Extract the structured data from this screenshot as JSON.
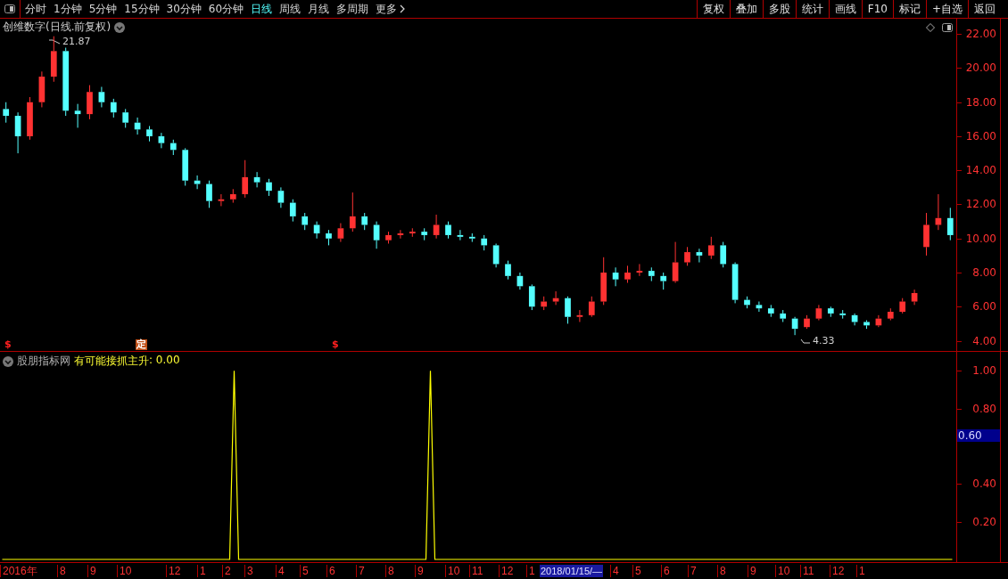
{
  "toolbar": {
    "tabs": [
      {
        "label": "分时",
        "selected": false
      },
      {
        "label": "1分钟",
        "selected": false
      },
      {
        "label": "5分钟",
        "selected": false
      },
      {
        "label": "15分钟",
        "selected": false
      },
      {
        "label": "30分钟",
        "selected": false
      },
      {
        "label": "60分钟",
        "selected": false
      },
      {
        "label": "日线",
        "selected": true
      },
      {
        "label": "周线",
        "selected": false
      },
      {
        "label": "月线",
        "selected": false
      },
      {
        "label": "多周期",
        "selected": false
      },
      {
        "label": "更多",
        "selected": false,
        "kind": "more"
      }
    ],
    "buttons": [
      "复权",
      "叠加",
      "多股",
      "统计",
      "画线",
      "F10",
      "标记",
      "+自选",
      "返回"
    ]
  },
  "main_chart": {
    "title": "创维数字(日线.前复权)",
    "high_label": "21.87",
    "low_label": "4.33",
    "markers": [
      {
        "kind": "dollar",
        "text": "$"
      },
      {
        "kind": "badge",
        "text": "定"
      },
      {
        "kind": "dollar",
        "text": "$"
      }
    ],
    "chart_data": {
      "type": "candlestick",
      "ylim": [
        3.4,
        22.9
      ],
      "categories": [
        null,
        null,
        null,
        null,
        null,
        null,
        null,
        null,
        null,
        null,
        null,
        null,
        null,
        null,
        null,
        null,
        null,
        null,
        null,
        null,
        null,
        null,
        null,
        null,
        null,
        null,
        null,
        null,
        null,
        null,
        null,
        null,
        null,
        null,
        null,
        null,
        null,
        null,
        null,
        null,
        null,
        null,
        null,
        null,
        null,
        null,
        null,
        null,
        null,
        null,
        null,
        null,
        null,
        null,
        null,
        null,
        null,
        null,
        null,
        null,
        null,
        null,
        null,
        null,
        null,
        null,
        null,
        null,
        null,
        null,
        null,
        null,
        null,
        null,
        null,
        null,
        null,
        null,
        null,
        null
      ],
      "ohlc": [
        [
          17.6,
          18.0,
          16.8,
          17.2
        ],
        [
          17.2,
          17.4,
          15.0,
          16.0
        ],
        [
          16.0,
          18.3,
          15.8,
          18.0
        ],
        [
          18.0,
          19.8,
          17.7,
          19.5
        ],
        [
          19.5,
          21.87,
          19.2,
          21.0
        ],
        [
          21.0,
          21.2,
          17.2,
          17.5
        ],
        [
          17.5,
          17.9,
          16.5,
          17.3
        ],
        [
          17.3,
          19.0,
          17.0,
          18.6
        ],
        [
          18.6,
          18.9,
          17.7,
          18.0
        ],
        [
          18.0,
          18.2,
          17.1,
          17.4
        ],
        [
          17.4,
          17.6,
          16.5,
          16.8
        ],
        [
          16.8,
          17.1,
          16.1,
          16.4
        ],
        [
          16.4,
          16.6,
          15.7,
          16.0
        ],
        [
          16.0,
          16.2,
          15.3,
          15.6
        ],
        [
          15.6,
          15.8,
          14.9,
          15.2
        ],
        [
          15.2,
          15.3,
          13.1,
          13.4
        ],
        [
          13.4,
          13.7,
          12.9,
          13.2
        ],
        [
          13.2,
          13.4,
          11.8,
          12.2
        ],
        [
          12.2,
          12.6,
          11.9,
          12.3
        ],
        [
          12.3,
          12.9,
          12.1,
          12.6
        ],
        [
          12.6,
          14.6,
          12.4,
          13.6
        ],
        [
          13.6,
          13.9,
          13.0,
          13.3
        ],
        [
          13.3,
          13.5,
          12.5,
          12.8
        ],
        [
          12.8,
          13.0,
          11.8,
          12.1
        ],
        [
          12.1,
          12.3,
          11.0,
          11.3
        ],
        [
          11.3,
          11.5,
          10.5,
          10.8
        ],
        [
          10.8,
          11.0,
          10.0,
          10.3
        ],
        [
          10.3,
          10.5,
          9.6,
          10.0
        ],
        [
          10.0,
          10.9,
          9.8,
          10.6
        ],
        [
          10.6,
          12.7,
          10.4,
          11.3
        ],
        [
          11.3,
          11.5,
          10.5,
          10.8
        ],
        [
          10.8,
          11.0,
          9.4,
          9.9
        ],
        [
          9.9,
          10.4,
          9.7,
          10.2
        ],
        [
          10.2,
          10.5,
          10.0,
          10.3
        ],
        [
          10.3,
          10.6,
          10.1,
          10.4
        ],
        [
          10.4,
          10.6,
          9.9,
          10.2
        ],
        [
          10.2,
          11.4,
          10.0,
          10.8
        ],
        [
          10.8,
          11.0,
          10.0,
          10.2
        ],
        [
          10.2,
          10.5,
          9.9,
          10.1
        ],
        [
          10.1,
          10.3,
          9.8,
          10.0
        ],
        [
          10.0,
          10.2,
          9.3,
          9.6
        ],
        [
          9.6,
          9.7,
          8.3,
          8.5
        ],
        [
          8.5,
          8.7,
          7.6,
          7.8
        ],
        [
          7.8,
          8.0,
          7.0,
          7.2
        ],
        [
          7.2,
          7.3,
          5.8,
          6.0
        ],
        [
          6.0,
          6.6,
          5.8,
          6.3
        ],
        [
          6.3,
          6.9,
          6.1,
          6.5
        ],
        [
          6.5,
          6.6,
          5.0,
          5.4
        ],
        [
          5.4,
          5.8,
          5.1,
          5.5
        ],
        [
          5.5,
          6.6,
          5.4,
          6.3
        ],
        [
          6.3,
          8.9,
          6.1,
          8.0
        ],
        [
          8.0,
          8.3,
          7.2,
          7.6
        ],
        [
          7.6,
          8.4,
          7.4,
          8.0
        ],
        [
          8.0,
          8.5,
          7.8,
          8.1
        ],
        [
          8.1,
          8.3,
          7.5,
          7.8
        ],
        [
          7.8,
          8.0,
          7.0,
          7.5
        ],
        [
          7.5,
          9.8,
          7.4,
          8.6
        ],
        [
          8.6,
          9.5,
          8.4,
          9.2
        ],
        [
          9.2,
          9.4,
          8.6,
          9.0
        ],
        [
          9.0,
          10.1,
          8.8,
          9.6
        ],
        [
          9.6,
          9.8,
          8.3,
          8.5
        ],
        [
          8.5,
          8.6,
          6.2,
          6.4
        ],
        [
          6.4,
          6.6,
          5.9,
          6.1
        ],
        [
          6.1,
          6.3,
          5.7,
          5.9
        ],
        [
          5.9,
          6.1,
          5.4,
          5.6
        ],
        [
          5.6,
          5.8,
          5.1,
          5.3
        ],
        [
          5.3,
          5.4,
          4.33,
          4.7
        ],
        [
          4.8,
          5.5,
          4.7,
          5.3
        ],
        [
          5.3,
          6.1,
          5.2,
          5.9
        ],
        [
          5.9,
          6.0,
          5.4,
          5.6
        ],
        [
          5.6,
          5.8,
          5.3,
          5.5
        ],
        [
          5.5,
          5.6,
          4.9,
          5.1
        ],
        [
          5.1,
          5.2,
          4.7,
          4.9
        ],
        [
          4.9,
          5.5,
          4.8,
          5.3
        ],
        [
          5.3,
          5.9,
          5.2,
          5.7
        ],
        [
          5.7,
          6.5,
          5.6,
          6.3
        ],
        [
          6.3,
          7.0,
          6.1,
          6.8
        ],
        [
          9.5,
          11.5,
          9.0,
          10.8
        ],
        [
          10.8,
          12.6,
          10.5,
          11.2
        ],
        [
          11.2,
          11.8,
          9.9,
          10.2
        ]
      ],
      "yticks": [
        {
          "value": 22,
          "label": "22.00"
        },
        {
          "value": 20,
          "label": "20.00"
        },
        {
          "value": 18,
          "label": "18.00"
        },
        {
          "value": 16,
          "label": "16.00"
        },
        {
          "value": 14,
          "label": "14.00"
        },
        {
          "value": 12,
          "label": "12.00"
        },
        {
          "value": 10,
          "label": "10.00"
        },
        {
          "value": 8,
          "label": "8.00"
        },
        {
          "value": 6,
          "label": "6.00"
        },
        {
          "value": 4,
          "label": "4.00"
        }
      ]
    }
  },
  "indicator": {
    "source": "股朋指标网",
    "value": ": 0.00",
    "readout": "0.60",
    "chart_data": {
      "type": "line",
      "categories": [
        null,
        null,
        null,
        null,
        null,
        null,
        null,
        null,
        null,
        null,
        null,
        null,
        null,
        null,
        null,
        null,
        null,
        null,
        null,
        null,
        null,
        null,
        null,
        null,
        null,
        null,
        null,
        null,
        null,
        null,
        null,
        null,
        null,
        null,
        null,
        null,
        null,
        null,
        null,
        null,
        null,
        null,
        null,
        null,
        null,
        null,
        null,
        null,
        null,
        null,
        null,
        null,
        null,
        null,
        null,
        null,
        null,
        null,
        null,
        null,
        null,
        null,
        null,
        null,
        null,
        null,
        null,
        null,
        null,
        null,
        null,
        null,
        null,
        null,
        null,
        null,
        null,
        null,
        null,
        null,
        null,
        null,
        null,
        null,
        null,
        null,
        null,
        null,
        null,
        null,
        null,
        null,
        null,
        null,
        null,
        null,
        null,
        null,
        null,
        null,
        null,
        null,
        null,
        null,
        null,
        null,
        null,
        null,
        null,
        null,
        null,
        null,
        null,
        null,
        null,
        null,
        null,
        null,
        null,
        null,
        null,
        null,
        null,
        null,
        null,
        null,
        null,
        null,
        null,
        null,
        null,
        null,
        null,
        null,
        null,
        null,
        null,
        null,
        null,
        null,
        null,
        null,
        null,
        null,
        null,
        null,
        null,
        null,
        null,
        null,
        null,
        null,
        null,
        null,
        null,
        null,
        null,
        null,
        null,
        null,
        null,
        null,
        null,
        null,
        null,
        null,
        null,
        null,
        null,
        null,
        null,
        null,
        null,
        null,
        null,
        null,
        null,
        null,
        null,
        null,
        null,
        null,
        null,
        null,
        null,
        null,
        null,
        null,
        null,
        null,
        null,
        null,
        null,
        null,
        null,
        null,
        null,
        null,
        null,
        null,
        null,
        null,
        null,
        null,
        null,
        null,
        null,
        null,
        null,
        null,
        null,
        null,
        null,
        null
      ],
      "series": [
        {
          "name": "有可能接抓主升",
          "color": "#ffff00",
          "values": [
            0,
            0,
            0,
            0,
            0,
            0,
            0,
            0,
            0,
            0,
            0,
            0,
            0,
            0,
            0,
            0,
            0,
            0,
            0,
            0,
            0,
            0,
            0,
            0,
            0,
            0,
            0,
            0,
            0,
            0,
            0,
            0,
            0,
            0,
            0,
            0,
            0,
            0,
            0,
            0,
            0,
            0,
            0,
            0,
            0,
            0,
            0,
            0,
            0,
            0,
            0,
            0,
            1,
            0,
            0,
            0,
            0,
            0,
            0,
            0,
            0,
            0,
            0,
            0,
            0,
            0,
            0,
            0,
            0,
            0,
            0,
            0,
            0,
            0,
            0,
            0,
            0,
            0,
            0,
            0,
            0,
            0,
            0,
            0,
            0,
            0,
            0,
            0,
            0,
            0,
            0,
            0,
            0,
            0,
            0,
            0,
            1,
            0,
            0,
            0,
            0,
            0,
            0,
            0,
            0,
            0,
            0,
            0,
            0,
            0,
            0,
            0,
            0,
            0,
            0,
            0,
            0,
            0,
            0,
            0,
            0,
            0,
            0,
            0,
            0,
            0,
            0,
            0,
            0,
            0,
            0,
            0,
            0,
            0,
            0,
            0,
            0,
            0,
            0,
            0,
            0,
            0,
            0,
            0,
            0,
            0,
            0,
            0,
            0,
            0,
            0,
            0,
            0,
            0,
            0,
            0,
            0,
            0,
            0,
            0,
            0,
            0,
            0,
            0,
            0,
            0,
            0,
            0,
            0,
            0,
            0,
            0,
            0,
            0,
            0,
            0,
            0,
            0,
            0,
            0,
            0,
            0,
            0,
            0,
            0,
            0,
            0,
            0,
            0,
            0,
            0,
            0,
            0,
            0,
            0,
            0,
            0,
            0,
            0,
            0,
            0,
            0,
            0,
            0,
            0,
            0,
            0,
            0,
            0,
            0,
            0,
            0,
            0,
            0
          ]
        }
      ],
      "ylim": [
        0,
        1.1
      ],
      "yticks": [
        {
          "value": 0.2,
          "label": "0.20"
        },
        {
          "value": 0.4,
          "label": "0.40"
        },
        {
          "value": 0.8,
          "label": "0.80"
        },
        {
          "value": 1.0,
          "label": "1.00"
        }
      ]
    }
  },
  "time_axis": {
    "labels": [
      {
        "text": "2016年",
        "kind": "date"
      },
      {
        "text": "8",
        "kind": "date"
      },
      {
        "text": "9",
        "kind": "date"
      },
      {
        "text": "10",
        "kind": "date"
      },
      {
        "text": "12",
        "kind": "date"
      },
      {
        "text": "1",
        "kind": "date"
      },
      {
        "text": "2",
        "kind": "date"
      },
      {
        "text": "3",
        "kind": "date"
      },
      {
        "text": "4",
        "kind": "date"
      },
      {
        "text": "5",
        "kind": "date"
      },
      {
        "text": "6",
        "kind": "date"
      },
      {
        "text": "7",
        "kind": "date"
      },
      {
        "text": "8",
        "kind": "date"
      },
      {
        "text": "9",
        "kind": "date"
      },
      {
        "text": "10",
        "kind": "date"
      },
      {
        "text": "11",
        "kind": "date"
      },
      {
        "text": "12",
        "kind": "date"
      },
      {
        "text": "1",
        "kind": "date"
      },
      {
        "text": "2018/01/15/—",
        "kind": "cursor"
      },
      {
        "text": "4",
        "kind": "date"
      },
      {
        "text": "5",
        "kind": "date"
      },
      {
        "text": "6",
        "kind": "date"
      },
      {
        "text": "7",
        "kind": "date"
      },
      {
        "text": "8",
        "kind": "date"
      },
      {
        "text": "9",
        "kind": "date"
      },
      {
        "text": "10",
        "kind": "date"
      },
      {
        "text": "11",
        "kind": "date"
      },
      {
        "text": "12",
        "kind": "date"
      },
      {
        "text": "1",
        "kind": "date"
      }
    ]
  }
}
